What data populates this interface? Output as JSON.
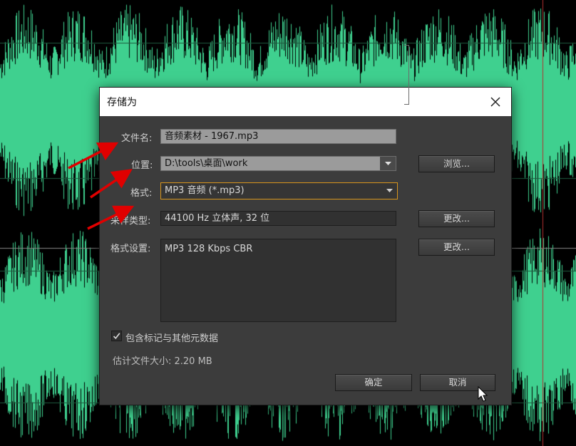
{
  "dialog": {
    "title": "存储为",
    "close_icon": "close-icon",
    "filename_label": "文件名:",
    "filename_value": "音频素材 - 1967.mp3",
    "location_label": "位置:",
    "location_value": "D:\\tools\\桌面\\work",
    "format_label": "格式:",
    "format_value": "MP3 音频 (*.mp3)",
    "sample_type_label": "采样类型:",
    "sample_type_value": "44100 Hz 立体声, 32 位",
    "format_settings_label": "格式设置:",
    "format_settings_value": "MP3 128 Kbps CBR",
    "browse_button": "浏览...",
    "change_button_1": "更改...",
    "change_button_2": "更改...",
    "include_markers_label": "包含标记与其他元数据",
    "include_markers_checked": true,
    "estimated_size": "估计文件大小: 2.20 MB",
    "ok_button": "确定",
    "cancel_button": "取消"
  },
  "colors": {
    "waveform": "#3fd08f",
    "background": "#000000",
    "dialog_bg": "#3c3c3c",
    "annotation_arrow": "#e00000",
    "format_focus": "#d7951c"
  }
}
